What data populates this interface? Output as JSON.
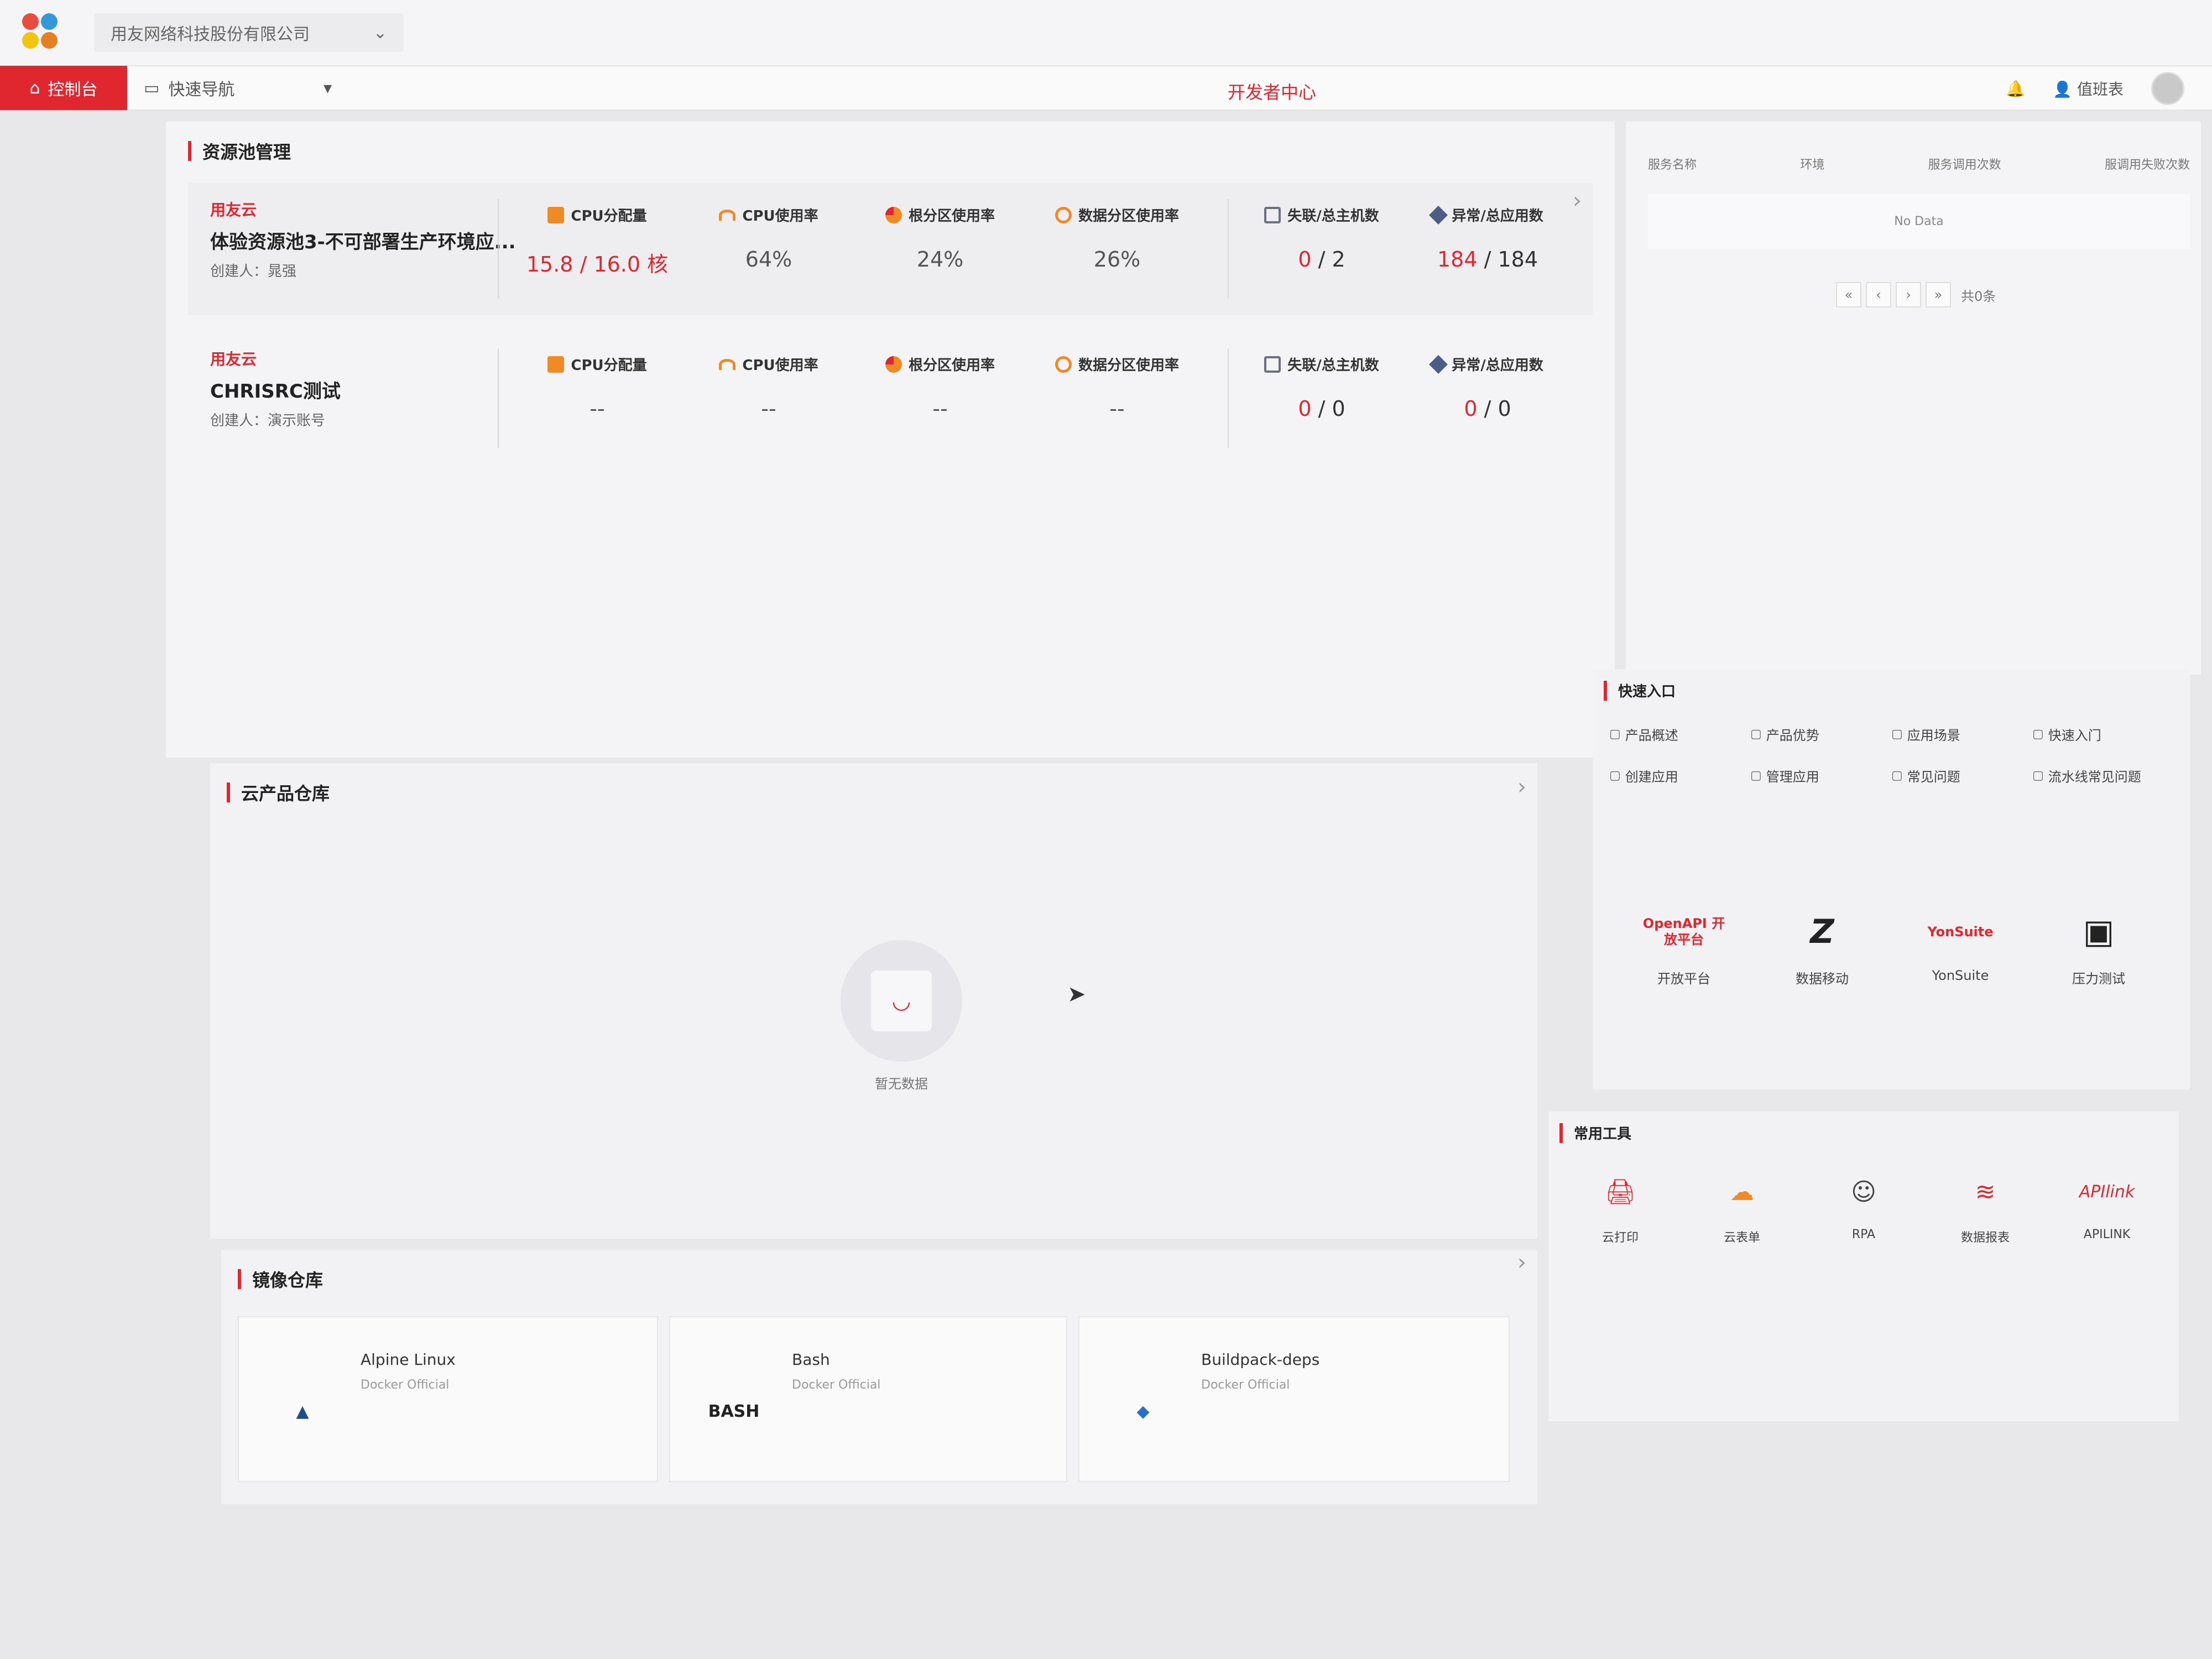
{
  "header": {
    "org": "用友网络科技股份有限公司",
    "tabs": {
      "home": "控制台",
      "nav": "快速导航"
    },
    "center_title": "开发者中心",
    "user": "值班表"
  },
  "pool": {
    "title": "资源池管理",
    "cards": [
      {
        "brand": "用友云",
        "name": "体验资源池3-不可部署生产环境应...",
        "creator": "创建人：晁强",
        "cpu_alloc_label": "CPU分配量",
        "cpu_alloc_used": "15.8",
        "cpu_alloc_total": "/ 16.0 核",
        "cpu_usage_label": "CPU使用率",
        "cpu_usage": "64%",
        "root_label": "根分区使用率",
        "root_usage": "24%",
        "data_label": "数据分区使用率",
        "data_usage": "26%",
        "host_label": "失联/总主机数",
        "host_val": "0",
        "host_total": " / 2",
        "app_label": "异常/总应用数",
        "app_val": "184",
        "app_total": " / 184"
      },
      {
        "brand": "用友云",
        "name": "CHRISRC测试",
        "creator": "创建人：演示账号",
        "cpu_alloc_label": "CPU分配量",
        "cpu_alloc_used": "--",
        "cpu_alloc_total": "",
        "cpu_usage_label": "CPU使用率",
        "cpu_usage": "--",
        "root_label": "根分区使用率",
        "root_usage": "--",
        "data_label": "数据分区使用率",
        "data_usage": "--",
        "host_label": "失联/总主机数",
        "host_val": "0",
        "host_total": " / 0",
        "app_label": "异常/总应用数",
        "app_val": "0",
        "app_total": " / 0"
      }
    ]
  },
  "services": {
    "columns": [
      "服务名称",
      "环境",
      "服务调用次数",
      "服调用失败次数"
    ],
    "empty": "No Data",
    "pager": {
      "first": "«",
      "prev": "‹",
      "next": "›",
      "last": "»",
      "total": "共0条"
    }
  },
  "cloud": {
    "title": "云产品仓库",
    "empty": "暂无数据"
  },
  "quick": {
    "title": "快速入口",
    "links": [
      "产品概述",
      "产品优势",
      "应用场景",
      "快速入门",
      "创建应用",
      "管理应用",
      "常见问题",
      "流水线常见问题"
    ],
    "apps": [
      {
        "logo": "OpenAPI 开放平台",
        "name": "开放平台"
      },
      {
        "logo": "Z",
        "name": "数据移动"
      },
      {
        "logo": "YonSuite",
        "name": "YonSuite"
      },
      {
        "logo": "▣",
        "name": "压力测试"
      }
    ]
  },
  "tools": {
    "title": "常用工具",
    "items": [
      {
        "icon": "printer-icon",
        "name": "云打印"
      },
      {
        "icon": "cloud-form-icon",
        "name": "云表单"
      },
      {
        "icon": "robot-icon",
        "name": "RPA"
      },
      {
        "icon": "report-icon",
        "name": "数据报表"
      },
      {
        "logo": "APIlink",
        "name": "APILINK"
      }
    ]
  },
  "mirror": {
    "title": "镜像仓库",
    "items": [
      {
        "name": "Alpine Linux",
        "sub": "Docker Official",
        "logo": "▲"
      },
      {
        "name": "Bash",
        "sub": "Docker Official",
        "logo": "BASH"
      },
      {
        "name": "Buildpack-deps",
        "sub": "Docker Official",
        "logo": "◆"
      }
    ]
  },
  "colors": {
    "accent": "#e0262e",
    "orange": "#f08a24"
  }
}
